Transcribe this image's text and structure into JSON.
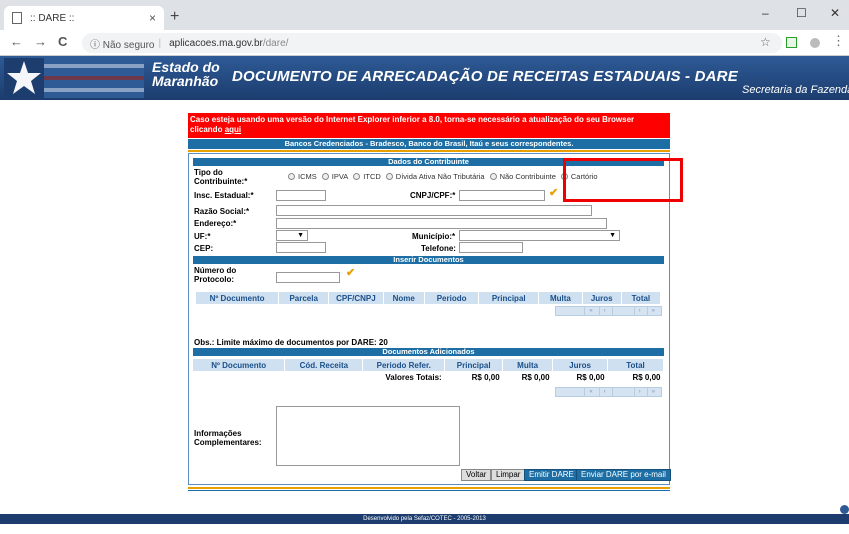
{
  "browser": {
    "tab_title": ":: DARE ::",
    "tab_close": "×",
    "new_tab": "+",
    "window_controls": [
      "–",
      "☐",
      "✕"
    ],
    "back": "←",
    "forward": "→",
    "reload": "C",
    "security_label": "ⓘ Não seguro",
    "url_host": "aplicacoes.ma.gov.br",
    "url_path": "/dare/",
    "star_icon": "☆"
  },
  "banner": {
    "state_line1": "Estado do",
    "state_line2": "Maranhão",
    "title": "DOCUMENTO DE ARRECADAÇÃO DE RECEITAS ESTADUAIS - DARE",
    "secretaria": "Secretaria da Fazenda"
  },
  "alert": {
    "text": "Caso esteja usando uma versão do Internet Explorer inferior a 8.0, torna-se necessário a atualização do seu Browser clicando",
    "link": "aqui"
  },
  "banks": "Bancos Credenciados - Bradesco, Banco do Brasil, Itaú e seus correspondentes.",
  "contribuinte": {
    "section_title": "Dados do Contribuinte",
    "tipo_label_1": "Tipo do",
    "tipo_label_2": "Contribuinte:*",
    "options": [
      "ICMS",
      "IPVA",
      "ITCD",
      "Dívida Ativa Não Tributária",
      "Não Contribuinte",
      "Cartório"
    ],
    "selected": "Cartório",
    "insc_label": "Insc. Estadual:*",
    "cnpj_label": "CNPJ/CPF:*",
    "razao_label": "Razão Social:*",
    "endereco_label": "Endereço:*",
    "uf_label": "UF:*",
    "municipio_label": "Município:*",
    "cep_label": "CEP:",
    "telefone_label": "Telefone:",
    "dropdown_arrow": "▼"
  },
  "inserir": {
    "section_title": "Inserir Documentos",
    "protocolo_label_1": "Número do",
    "protocolo_label_2": "Protocolo:",
    "columns": [
      "Nº Documento",
      "Parcela",
      "CPF/CNPJ",
      "Nome",
      "Periodo",
      "Principal",
      "Multa",
      "Juros",
      "Total"
    ],
    "pager": [
      "«",
      "‹",
      "",
      "›",
      "»"
    ],
    "obs": "Obs.: Limite máximo de documentos por DARE: 20"
  },
  "adicionados": {
    "section_title": "Documentos Adicionados",
    "columns": [
      "Nº Documento",
      "Cód. Receita",
      "Periodo Refer.",
      "Principal",
      "Multa",
      "Juros",
      "Total"
    ],
    "totals_label": "Valores Totais:",
    "totals": [
      "R$ 0,00",
      "R$ 0,00",
      "R$ 0,00",
      "R$ 0,00"
    ],
    "pager": [
      "«",
      "‹",
      "",
      "›",
      "»"
    ]
  },
  "info": {
    "label_1": "Informações",
    "label_2": "Complementares:"
  },
  "buttons": {
    "voltar": "Voltar",
    "limpar": "Limpar",
    "emitir": "Emitir DARE",
    "enviar": "Enviar DARE por e-mail"
  },
  "footer": "Desenvolvido pela Sefaz/COTEC - 2005-2013",
  "colors": {
    "accent": "#1c6ea4",
    "alert": "#ff0000",
    "banner": "#2e5a96",
    "highlight": "#e00000"
  }
}
